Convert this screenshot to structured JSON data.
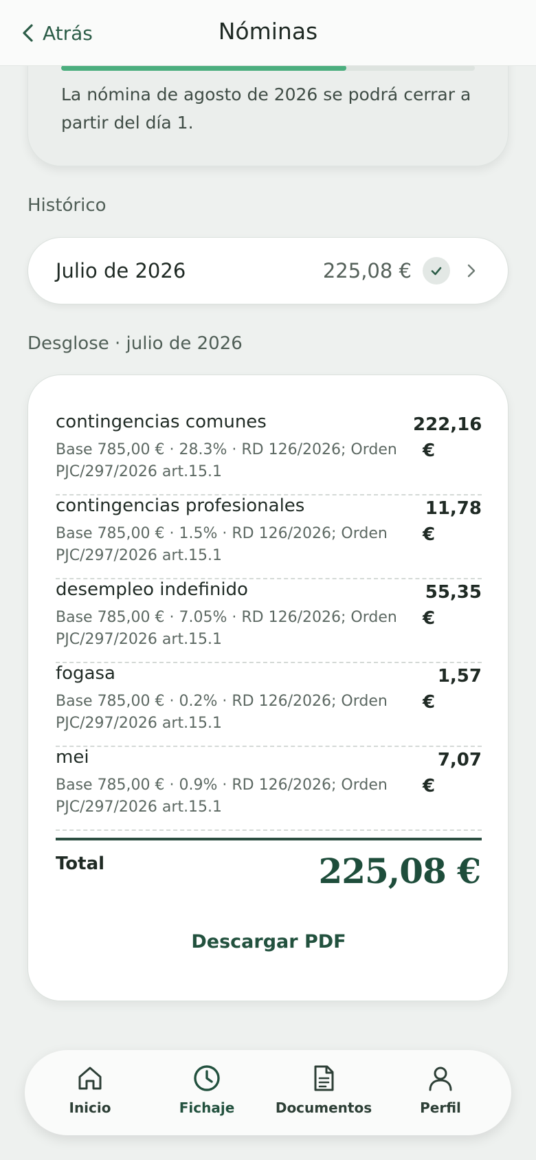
{
  "header": {
    "back_label": "Atrás",
    "title": "Nóminas"
  },
  "info_card": {
    "progress_fraction": 0.69,
    "message": "La nómina de agosto de 2026 se podrá cerrar a partir del día 1."
  },
  "history": {
    "section_label": "Histórico",
    "items": [
      {
        "month": "Julio de 2026",
        "amount": "225,08 €",
        "status_icon": "check-icon"
      }
    ]
  },
  "breakdown": {
    "section_label": "Desglose · julio de 2026",
    "items": [
      {
        "name": "contingencias comunes",
        "detail": "Base 785,00 € · 28.3% · RD 126/2026; Orden PJC/297/2026 art.15.1",
        "amount": "222,16",
        "currency": "€"
      },
      {
        "name": "contingencias profesionales",
        "detail": "Base 785,00 € · 1.5% · RD 126/2026; Orden PJC/297/2026 art.15.1",
        "amount": "11,78",
        "currency": "€"
      },
      {
        "name": "desempleo indefinido",
        "detail": "Base 785,00 € · 7.05% · RD 126/2026; Orden PJC/297/2026 art.15.1",
        "amount": "55,35",
        "currency": "€"
      },
      {
        "name": "fogasa",
        "detail": "Base 785,00 € · 0.2% · RD 126/2026; Orden PJC/297/2026 art.15.1",
        "amount": "1,57",
        "currency": "€"
      },
      {
        "name": "mei",
        "detail": "Base 785,00 € · 0.9% · RD 126/2026; Orden PJC/297/2026 art.15.1",
        "amount": "7,07",
        "currency": "€"
      }
    ],
    "total_label": "Total",
    "total_amount": "225,08 €",
    "download_label": "Descargar PDF"
  },
  "nav": {
    "items": [
      {
        "label": "Inicio",
        "icon": "home-icon"
      },
      {
        "label": "Fichaje",
        "icon": "clock-icon",
        "active": true
      },
      {
        "label": "Documentos",
        "icon": "document-icon"
      },
      {
        "label": "Perfil",
        "icon": "user-icon"
      }
    ]
  },
  "colors": {
    "accent": "#1e4d3b",
    "progress": "#4bae7e",
    "background": "#eef1ef"
  }
}
